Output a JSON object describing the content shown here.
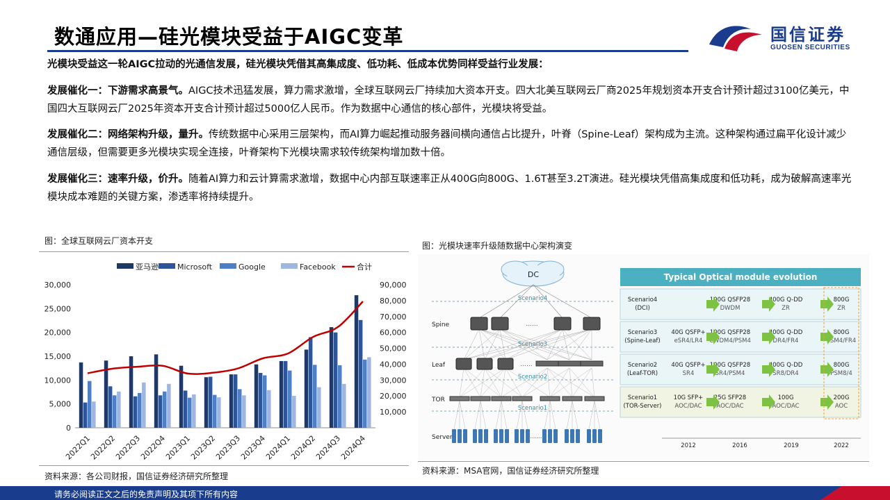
{
  "header": {
    "title": "数通应用—硅光模块受益于AIGC变革",
    "logo_cn": "国信证券",
    "logo_en": "GUOSEN SECURITIES",
    "brand_blue": "#1a3c8c",
    "brand_red": "#c8102e"
  },
  "body": {
    "intro": "光模块受益这一轮AIGC拉动的光通信发展，硅光模块凭借其高集成度、低功耗、低成本优势同样受益行业发展：",
    "p1_lead": "发展催化一：下游需求高景气。",
    "p1_text": "AIGC技术迅猛发展，算力需求激增，全球互联网云厂持续加大资本开支。四大北美互联网云厂商2025年规划资本开支合计预计超过3100亿美元，中国四大互联网云厂2025年资本开支合计预计超过5000亿人民币。作为数据中心通信的核心部件，光模块将受益。",
    "p2_lead": "发展催化二：网络架构升级，量升。",
    "p2_text": "传统数据中心采用三层架构，而AI算力崛起推动服务器间横向通信占比提升，叶脊（Spine-Leaf）架构成为主流。这种架构通过扁平化设计减少通信层级，但需要更多光模块实现全连接，叶脊架构下光模块需求较传统架构增加数十倍。",
    "p3_lead": "发展催化三：速率升级，价升。",
    "p3_text": "随着AI算力和云计算需求激增，数据中心内部互联速率正从400G向800G、1.6T甚至3.2T演进。硅光模块凭借高集成度和低功耗，成为破解高速率光模块成本难题的关键方案，渗透率将持续提升。"
  },
  "left_figure": {
    "caption": "图：全球互联网云厂资本开支",
    "source": "资料来源：各公司财报，国信证券经济研究所整理"
  },
  "right_figure": {
    "caption": "图：光模块速率升级随数据中心架构演变",
    "source": "资料来源：MSA官网，国信证券经济研究所整理",
    "diagram": {
      "dc_label": "DC",
      "layers": [
        "Spine",
        "Leaf",
        "TOR",
        "Server"
      ],
      "scenario_labels": [
        "Scenario4",
        "Scenario3",
        "Scenario2",
        "Scenario1"
      ],
      "ellipsis": "......",
      "table_title": "Typical Optical module evolution",
      "years": [
        "2012",
        "2016",
        "2019",
        "2022"
      ],
      "rows": [
        {
          "scenario": "Scenario4",
          "sub": "(DCI)",
          "cells": [
            {
              "a": "",
              "b": ""
            },
            {
              "a": "100G QSFP28",
              "b": "DWDM"
            },
            {
              "a": "400G Q-DD",
              "b": "ZR"
            },
            {
              "a": "800G",
              "b": "ZR"
            }
          ]
        },
        {
          "scenario": "Scenario3",
          "sub": "(Spine-Leaf)",
          "cells": [
            {
              "a": "40G QSFP+",
              "b": "eSR4/LR4"
            },
            {
              "a": "100G QSFP28",
              "b": "CWDM4/PSM4"
            },
            {
              "a": "400G Q-DD",
              "b": "DR4/FR4"
            },
            {
              "a": "800G",
              "b": "PSM4/FR4"
            }
          ]
        },
        {
          "scenario": "Scenario2",
          "sub": "(Leaf-TOR)",
          "cells": [
            {
              "a": "40G QSFP+",
              "b": "SR4"
            },
            {
              "a": "100G QSFP28",
              "b": "SR4/PSM4"
            },
            {
              "a": "400G Q-DD",
              "b": "SR8/DR4"
            },
            {
              "a": "800G",
              "b": "PSM8/4"
            }
          ]
        },
        {
          "scenario": "Scenario1",
          "sub": "(TOR-Server)",
          "cells": [
            {
              "a": "10G SFP+",
              "b": "AOC/DAC"
            },
            {
              "a": "25G SFP28",
              "b": "AOC/DAC"
            },
            {
              "a": "100G",
              "b": "AOC/DAC"
            },
            {
              "a": "200G",
              "b": "AOC"
            }
          ]
        }
      ]
    }
  },
  "footer": {
    "disclaimer": "请务必阅读正文之后的免责声明及其项下所有内容"
  },
  "chart_data": {
    "type": "bar",
    "categories": [
      "2022Q1",
      "2022Q2",
      "2022Q3",
      "2022Q4",
      "2023Q1",
      "2023Q2",
      "2023Q3",
      "2023Q4",
      "2024Q1",
      "2024Q2",
      "2024Q3",
      "2024Q4"
    ],
    "series": [
      {
        "name": "亚马逊",
        "color": "#1f3864",
        "axis": "left",
        "values": [
          13700,
          14100,
          15000,
          15400,
          13000,
          10600,
          11200,
          13300,
          14000,
          16400,
          21100,
          27800
        ]
      },
      {
        "name": "Microsoft",
        "color": "#2e5597",
        "axis": "left",
        "values": [
          5300,
          8700,
          6600,
          6800,
          7800,
          10700,
          11200,
          11500,
          14000,
          19000,
          20000,
          22600
        ]
      },
      {
        "name": "Google",
        "color": "#4f7fc4",
        "axis": "left",
        "values": [
          9800,
          6800,
          7300,
          7600,
          6300,
          6900,
          8100,
          11000,
          12000,
          13200,
          13100,
          14300
        ]
      },
      {
        "name": "Facebook",
        "color": "#9fb7de",
        "axis": "left",
        "values": [
          5500,
          7600,
          9500,
          9200,
          7000,
          6400,
          6800,
          7900,
          6700,
          8500,
          9200,
          14800
        ]
      },
      {
        "name": "合计",
        "type": "line",
        "color": "#c00000",
        "axis": "right",
        "values": [
          34300,
          37200,
          38400,
          39000,
          34100,
          34600,
          37300,
          43700,
          46700,
          57100,
          63400,
          79500
        ]
      }
    ],
    "y_left": {
      "min": 0,
      "max": 30000,
      "ticks": [
        0,
        5000,
        10000,
        15000,
        20000,
        25000,
        30000
      ],
      "tick_labels": [
        "0",
        "5,000",
        "10,000",
        "15,000",
        "20,000",
        "25,000",
        "30,000"
      ]
    },
    "y_right": {
      "min": 0,
      "max": 90000,
      "ticks": [
        0,
        10000,
        20000,
        30000,
        40000,
        50000,
        60000,
        70000,
        80000,
        90000
      ],
      "tick_labels": [
        "",
        "10,000",
        "20,000",
        "30,000",
        "40,000",
        "50,000",
        "60,000",
        "70,000",
        "80,000",
        "90,000"
      ]
    },
    "legend_position": "top",
    "grid": false
  }
}
